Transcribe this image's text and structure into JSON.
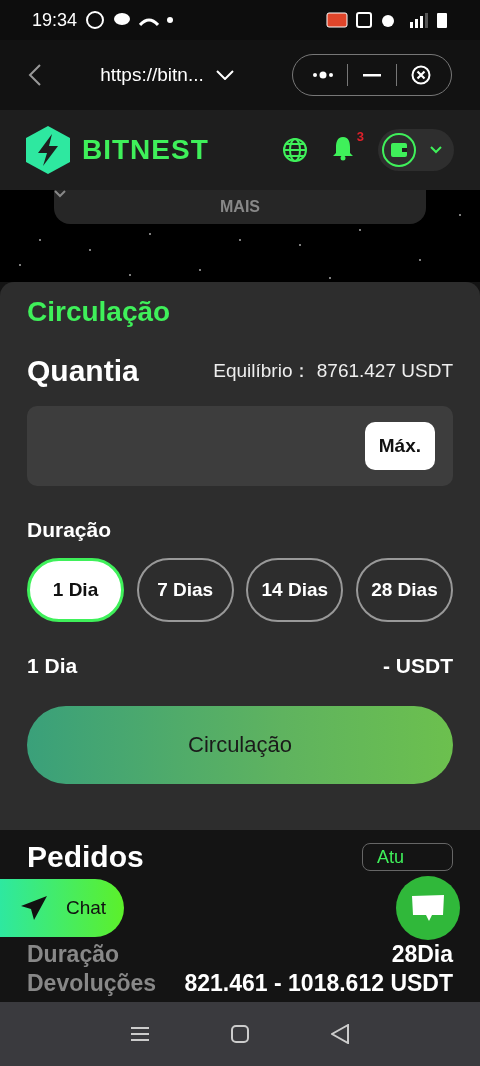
{
  "status_bar": {
    "time": "19:34"
  },
  "browser": {
    "url": "https://bitn..."
  },
  "header": {
    "logo": "BITNEST",
    "notification_count": "3"
  },
  "more_menu": {
    "label": "MAIS"
  },
  "form": {
    "title": "Circulação",
    "amount_label": "Quantia",
    "balance_label": "Equilíbrio：",
    "balance": "8761.427 USDT",
    "max_button": "Máx.",
    "duration_label": "Duração",
    "durations": [
      {
        "label": "1 Dia",
        "selected": true
      },
      {
        "label": "7 Dias",
        "selected": false
      },
      {
        "label": "14 Dias",
        "selected": false
      },
      {
        "label": "28 Dias",
        "selected": false
      }
    ],
    "summary_days": "1 Dia",
    "summary_amount": "- USDT",
    "submit": "Circulação"
  },
  "orders": {
    "title": "Pedidos",
    "refresh": "Atu",
    "rows": [
      {
        "label": "Duração",
        "value": "28Dia"
      },
      {
        "label": "Devoluções",
        "value": "821.461 - 1018.612 USDT"
      }
    ]
  },
  "chat": {
    "label": "Chat"
  }
}
